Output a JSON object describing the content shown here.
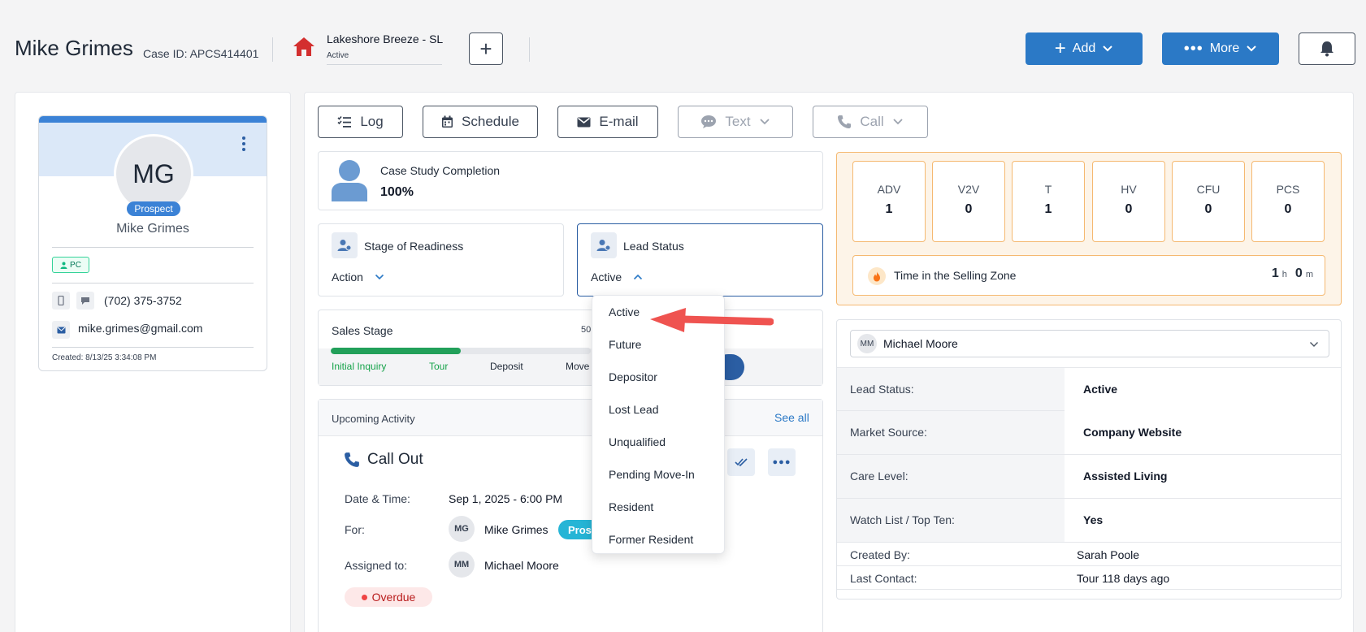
{
  "header": {
    "name": "Mike Grimes",
    "case_id": "Case ID: APCS414401",
    "property_name": "Lakeshore Breeze - SL",
    "property_status": "Active",
    "add_label": "Add",
    "more_label": "More"
  },
  "profile": {
    "initials": "MG",
    "badge": "Prospect",
    "name": "Mike Grimes",
    "tag": "PC",
    "phone": "(702) 375-3752",
    "email": "mike.grimes@gmail.com",
    "created": "Created: 8/13/25 3:34:08 PM"
  },
  "actions": {
    "log": "Log",
    "schedule": "Schedule",
    "email": "E-mail",
    "text": "Text",
    "call": "Call"
  },
  "case_study": {
    "title": "Case Study Completion",
    "value": "100%"
  },
  "stage_of_readiness": {
    "title": "Stage of Readiness",
    "value": "Action"
  },
  "lead_status": {
    "title": "Lead Status",
    "value": "Active"
  },
  "sales_stage": {
    "title": "Sales Stage",
    "percent_partial": "50",
    "progress": 0.5,
    "stages": [
      "Initial Inquiry",
      "Tour",
      "Deposit",
      "Move"
    ]
  },
  "upcoming": {
    "title": "Upcoming Activity",
    "see_all": "See all",
    "activity_title": "Call Out",
    "date_label": "Date & Time:",
    "date_value": "Sep 1, 2025 - 6:00 PM",
    "for_label": "For:",
    "for_initials": "MG",
    "for_name": "Mike Grimes",
    "for_badge": "Prosp",
    "assigned_label": "Assigned to:",
    "assigned_initials": "MM",
    "assigned_name": "Michael Moore",
    "status": "Overdue"
  },
  "metrics": [
    {
      "label": "ADV",
      "value": "1"
    },
    {
      "label": "V2V",
      "value": "0"
    },
    {
      "label": "T",
      "value": "1"
    },
    {
      "label": "HV",
      "value": "0"
    },
    {
      "label": "CFU",
      "value": "0"
    },
    {
      "label": "PCS",
      "value": "0"
    }
  ],
  "selling_zone": {
    "label": "Time in the Selling Zone",
    "hours": "1",
    "h": "h",
    "minutes": "0",
    "m": "m"
  },
  "assignee": {
    "initials": "MM",
    "name": "Michael Moore"
  },
  "details": {
    "lead_status_key": "Lead Status:",
    "lead_status_val": "Active",
    "market_source_key": "Market Source:",
    "market_source_val": "Company Website",
    "care_level_key": "Care Level:",
    "care_level_val": "Assisted Living",
    "watch_key": "Watch List / Top Ten:",
    "watch_val": "Yes",
    "created_by_key": "Created By:",
    "created_by_val": "Sarah Poole",
    "last_contact_key": "Last Contact:",
    "last_contact_val": "Tour 118 days ago"
  },
  "dropdown": {
    "items": [
      "Active",
      "Future",
      "Depositor",
      "Lost Lead",
      "Unqualified",
      "Pending Move-In",
      "Resident",
      "Former Resident"
    ]
  },
  "colors": {
    "primary": "#2b79c6",
    "progress": "#22a05a",
    "accent_orange": "#f5b971",
    "arrow": "#ef5350"
  }
}
